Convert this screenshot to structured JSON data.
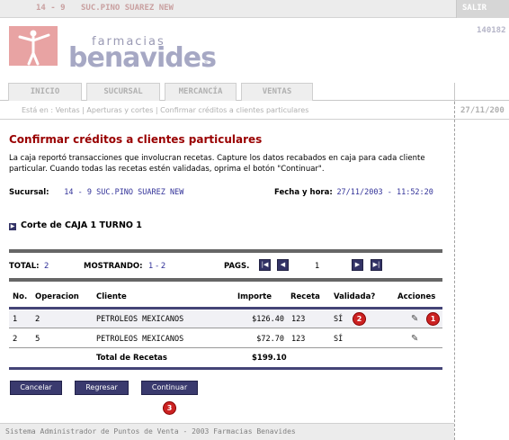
{
  "topbar": {
    "branch_code": "14 - 9",
    "branch_name": "SUC.PINO SUAREZ NEW",
    "logout_label": "SALIR"
  },
  "logo": {
    "brand_small": "farmacias",
    "brand_big": "benavides",
    "registered": "®"
  },
  "right_code": "140182",
  "tabs": [
    {
      "label": "INICIO"
    },
    {
      "label": "SUCURSAL"
    },
    {
      "label": "MERCANCÍA"
    },
    {
      "label": "VENTAS"
    }
  ],
  "breadcrumb": {
    "text": "Está en : Ventas | Aperturas y cortes | Confirmar créditos a clientes particulares",
    "date": "27/11/200"
  },
  "page": {
    "title": "Confirmar créditos a clientes particulares",
    "intro": "La caja reportó transacciones que involucran recetas. Capture los datos recabados en caja para cada cliente particular. Cuando todas las recetas estén validadas, oprima el botón \"Continuar\".",
    "sucursal_label": "Sucursal:",
    "sucursal_value": "14 - 9  SUC.PINO SUAREZ NEW",
    "fecha_label": "Fecha y hora:",
    "fecha_value": "27/11/2003 - 11:52:20",
    "corte": "Corte de CAJA 1 TURNO 1"
  },
  "pager": {
    "total_label": "TOTAL:",
    "total_value": "2",
    "mostrando_label": "MOSTRANDO:",
    "mostrando_value": "1 - 2",
    "pags_label": "PAGS.",
    "page_number": "1"
  },
  "table": {
    "columns": [
      "No.",
      "Operacion",
      "Cliente",
      "Importe",
      "Receta",
      "Validada?",
      "Acciones"
    ],
    "rows": [
      {
        "no": "1",
        "operacion": "2",
        "cliente": "PETROLEOS MEXICANOS",
        "importe": "$126.40",
        "receta": "123",
        "validada": "SÍ"
      },
      {
        "no": "2",
        "operacion": "5",
        "cliente": "PETROLEOS MEXICANOS",
        "importe": "$72.70",
        "receta": "123",
        "validada": "SÍ"
      }
    ],
    "total_label": "Total de Recetas",
    "total_value": "$199.10"
  },
  "badges": [
    "1",
    "2",
    "3"
  ],
  "buttons": {
    "cancel": "Cancelar",
    "back": "Regresar",
    "continue": "Continuar"
  },
  "footer": "Sistema Administrador de Puntos de Venta - 2003 Farmacias Benavides",
  "colors": {
    "title": "#990000",
    "value_blue": "#333399",
    "button_bg": "#3a3a6e",
    "badge_red": "#cc2222"
  }
}
